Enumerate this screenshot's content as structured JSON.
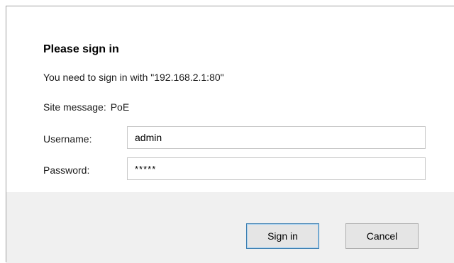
{
  "dialog": {
    "title": "Please sign in",
    "request_message": "You need to sign in with \"192.168.2.1:80\"",
    "site_message_label": "Site message:",
    "site_message_value": "PoE",
    "username_label": "Username:",
    "username_value": "admin",
    "password_label": "Password:",
    "password_value": "*****",
    "sign_in_label": "Sign in",
    "cancel_label": "Cancel"
  },
  "colors": {
    "footer_background": "#f0f0f0",
    "default_button_border": "#3c7fb1",
    "field_border": "#c8c8c8"
  }
}
